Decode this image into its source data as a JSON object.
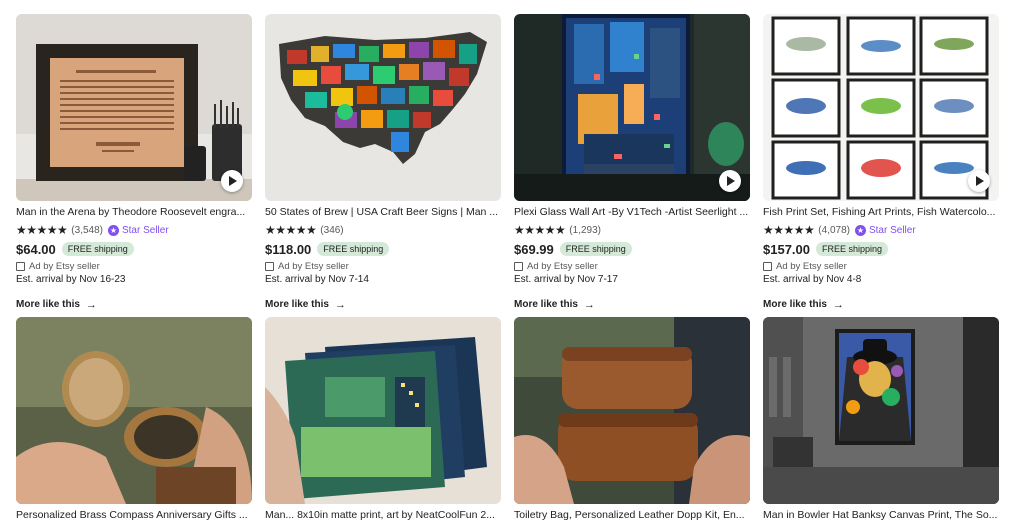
{
  "listings_row1": [
    {
      "image_alt": "Framed engraved leather print 'The Man In The Arena' on shelf",
      "title": "Man in the Arena by Theodore Roosevelt engra...",
      "stars": "★★★★★",
      "reviews": "(3,548)",
      "star_seller": "Star Seller",
      "price": "$64.00",
      "shipping": "FREE shipping",
      "ad_text": "Ad by Etsy seller",
      "arrival": "Est. arrival by Nov 16-23",
      "more": "More like this",
      "has_video": true
    },
    {
      "image_alt": "USA map made of craft beer labels",
      "title": "50 States of Brew | USA Craft Beer Signs | Man ...",
      "stars": "★★★★★",
      "reviews": "(346)",
      "star_seller": "",
      "price": "$118.00",
      "shipping": "FREE shipping",
      "ad_text": "Ad by Etsy seller",
      "arrival": "Est. arrival by Nov 7-14",
      "more": "More like this",
      "has_video": false
    },
    {
      "image_alt": "Neon cyberpunk city artwork on plexi glass",
      "title": "Plexi Glass Wall Art -By V1Tech -Artist Seerlight ...",
      "stars": "★★★★★",
      "reviews": "(1,293)",
      "star_seller": "",
      "price": "$69.99",
      "shipping": "FREE shipping",
      "ad_text": "Ad by Etsy seller",
      "arrival": "Est. arrival by Nov 7-17",
      "more": "More like this",
      "has_video": true
    },
    {
      "image_alt": "Grid of nine framed watercolor fish prints",
      "title": "Fish Print Set, Fishing Art Prints, Fish Watercolo...",
      "stars": "★★★★★",
      "reviews": "(4,078)",
      "star_seller": "Star Seller",
      "price": "$157.00",
      "shipping": "FREE shipping",
      "ad_text": "Ad by Etsy seller",
      "arrival": "Est. arrival by Nov 4-8",
      "more": "More like this",
      "has_video": true
    }
  ],
  "listings_row2": [
    {
      "image_alt": "Hands holding engraved brass compass",
      "title": "Personalized Brass Compass Anniversary Gifts ..."
    },
    {
      "image_alt": "Stack of matte art prints with green room illustration",
      "title": "Man... 8x10in matte print, art by NeatCoolFun 2..."
    },
    {
      "image_alt": "Two brown leather toiletry bags held in hands",
      "title": "Toiletry Bag, Personalized Leather Dopp Kit, En..."
    },
    {
      "image_alt": "Colorful man in bowler hat canvas print in loft",
      "title": "Man in Bowler Hat Banksy Canvas Print, The So..."
    }
  ]
}
